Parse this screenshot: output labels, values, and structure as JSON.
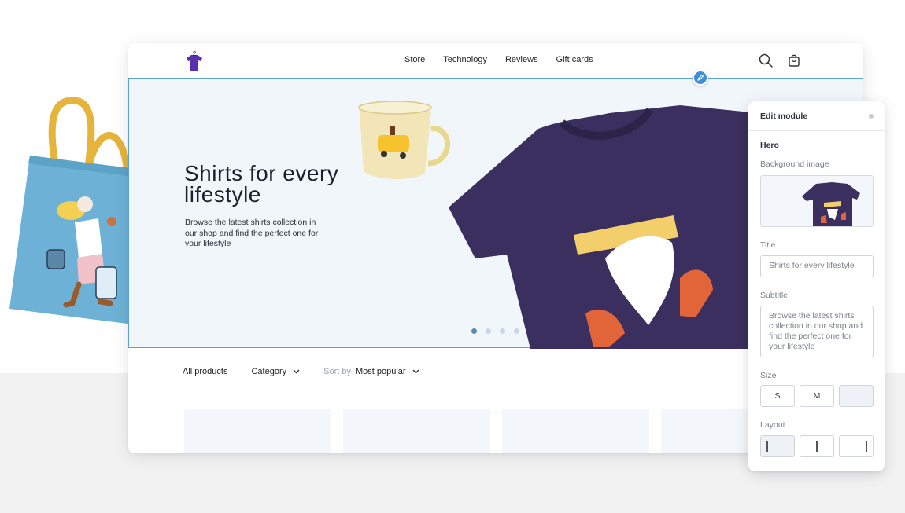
{
  "colors": {
    "accent": "#3f8fd6",
    "hero_border": "#5ea0d6",
    "shirt": "#3a2f5e",
    "tote": "#6db2d6",
    "tote_handle": "#e5b43a",
    "mug": "#f2e6b8"
  },
  "nav": {
    "logo_badge": "2",
    "links": [
      "Store",
      "Technology",
      "Reviews",
      "Gift cards"
    ],
    "search_icon": "search-icon",
    "cart_icon": "shopping-bag-icon"
  },
  "hero": {
    "title": "Shirts for every lifestyle",
    "subtitle": "Browse the latest shirts collection in our shop and find the perfect one for your lifestyle",
    "carousel_total": 4,
    "carousel_active": 1
  },
  "filters": {
    "all_products": "All products",
    "category": "Category",
    "sort_label": "Sort by",
    "sort_value": "Most popular"
  },
  "panel": {
    "header": "Edit module",
    "section": "Hero",
    "background_label": "Background image",
    "title_label": "Title",
    "title_value": "Shirts for every lifestyle",
    "subtitle_label": "Subtitle",
    "subtitle_value": "Browse the latest shirts collection in our shop and find the perfect one for your lifestyle",
    "size_label": "Size",
    "sizes": [
      "S",
      "M",
      "L"
    ],
    "size_selected": "L",
    "layout_label": "Layout",
    "layout_options": [
      "left",
      "center",
      "right"
    ],
    "layout_selected": "left"
  }
}
